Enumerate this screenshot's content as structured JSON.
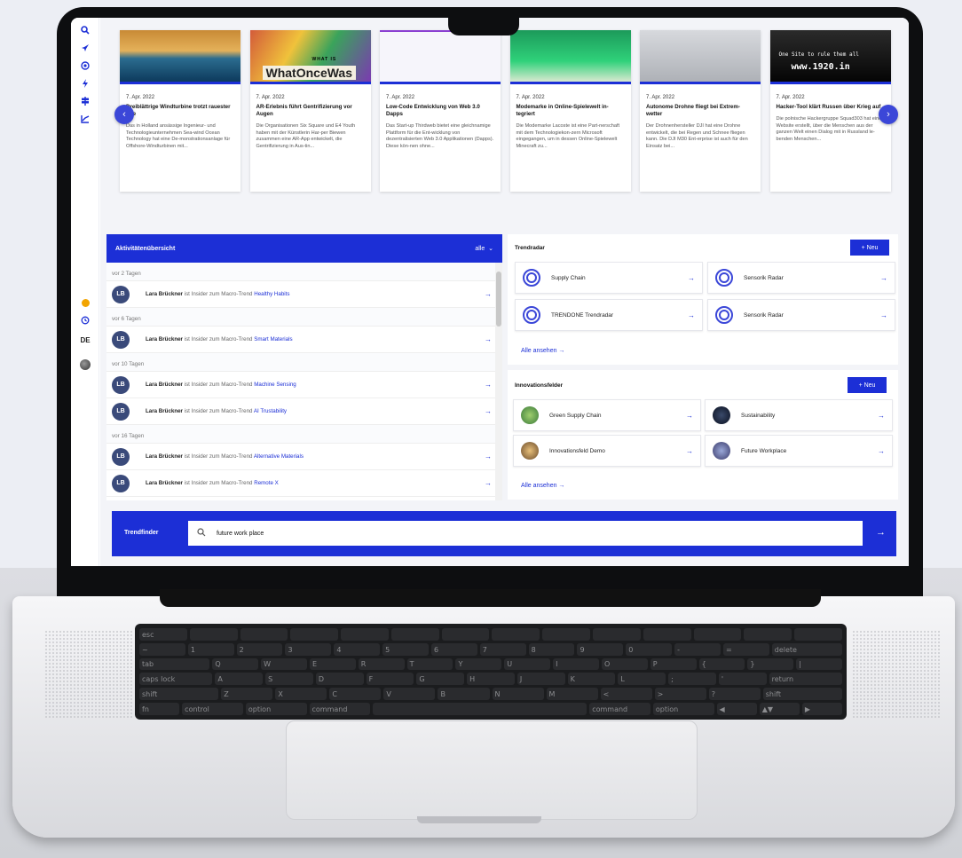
{
  "sidebar": {
    "icons": [
      "search-icon",
      "rocket-icon",
      "radar-icon",
      "bolt-icon",
      "signpost-icon",
      "chart-icon"
    ],
    "language": "DE"
  },
  "news": [
    {
      "date": "7. Apr. 2022",
      "title": "Dreiblättrige Windturbine trotzt rauester See",
      "text": "Das in Holland ansässige Ingenieur- und Technologieunternehmen Sea-wind Ocean Technology hat eine De-monstrationsanlage für Offshore-Windturbinen mit...",
      "img_caption": ""
    },
    {
      "date": "7. Apr. 2022",
      "title": "AR-Erlebnis führt Gentrifizierung vor Augen",
      "text": "Die Organisationen Six Square und E4 Youth haben mit der Künstlerin Har-per Biewen zusammen eine AR-App entwickelt, die Gentrifizierung in Aus-tin...",
      "img_caption": "WhatOnceWas",
      "img_caption_small": "WHAT IS"
    },
    {
      "date": "7. Apr. 2022",
      "title": "Low-Code Entwicklung von Web 3.0 Dapps",
      "text": "Das Start-up Thirdweb bietet eine gleichnamige Plattform für die Ent-wicklung von dezentralisierten Web 3.0 Applikationen (Dapps). Diese kön-nen ohne...",
      "img_caption": ""
    },
    {
      "date": "7. Apr. 2022",
      "title": "Modemarke in Online-Spielewelt in-tegriert",
      "text": "Die Modemarke Lacoste ist eine Part-nerschaft mit dem Technologiekon-zern Microsoft eingegangen, um in dessen Online-Spielewelt Minecraft zu...",
      "img_caption": ""
    },
    {
      "date": "7. Apr. 2022",
      "title": "Autonome Drohne fliegt bei Extrem-wetter",
      "text": "Der Drohnenhersteller DJI hat eine Drohne entwickelt, die bei Regen und Schnee fliegen kann. Die DJI M30 Ent-erprise ist auch für den Einsatz bei...",
      "img_caption": ""
    },
    {
      "date": "7. Apr. 2022",
      "title": "Hacker-Tool klärt Russen über Krieg auf",
      "text": "Die polnische Hackergruppe Squad303 hat eine Website erstellt, über die Menschen aus der ganzen Welt einen Dialog mit in Russland le-benden Menschen...",
      "img_caption": "www.1920.in",
      "img_caption_small": "One Site to rule them all"
    }
  ],
  "activity": {
    "title": "Aktivitätenübersicht",
    "filter": "alle",
    "groups": [
      {
        "label": "vor 2 Tagen",
        "items": [
          {
            "initials": "LB",
            "who": "Lara Brückner",
            "verb": "ist Insider zum Macro-Trend",
            "trend": "Healthy Habits"
          }
        ]
      },
      {
        "label": "vor 6 Tagen",
        "items": [
          {
            "initials": "LB",
            "who": "Lara Brückner",
            "verb": "ist Insider zum Macro-Trend",
            "trend": "Smart Materials"
          }
        ]
      },
      {
        "label": "vor 10 Tagen",
        "items": [
          {
            "initials": "LB",
            "who": "Lara Brückner",
            "verb": "ist Insider zum Macro-Trend",
            "trend": "Machine Sensing"
          },
          {
            "initials": "LB",
            "who": "Lara Brückner",
            "verb": "ist Insider zum Macro-Trend",
            "trend": "AI Trustability"
          }
        ]
      },
      {
        "label": "vor 16 Tagen",
        "items": [
          {
            "initials": "LB",
            "who": "Lara Brückner",
            "verb": "ist Insider zum Macro-Trend",
            "trend": "Alternative Materials"
          },
          {
            "initials": "LB",
            "who": "Lara Brückner",
            "verb": "ist Insider zum Macro-Trend",
            "trend": "Remote X"
          }
        ]
      }
    ]
  },
  "trendradar": {
    "title": "Trendradar",
    "new_label": "+ Neu",
    "items": [
      "Supply Chain",
      "Sensorik Radar",
      "TRENDONE Trendradar",
      "Sensorik Radar"
    ],
    "see_all": "Alle ansehen →"
  },
  "innovation": {
    "title": "Innovationsfelder",
    "new_label": "+ Neu",
    "items": [
      "Green Supply Chain",
      "Sustainability",
      "Innovationsfeld Demo",
      "Future Workplace"
    ],
    "see_all": "Alle ansehen →"
  },
  "trendfinder": {
    "label": "Trendfinder",
    "query": "future work place"
  },
  "keyboard": {
    "rows": [
      [
        "esc",
        "",
        "",
        "",
        "",
        "",
        "",
        "",
        "",
        "",
        "",
        "",
        "",
        ""
      ],
      [
        "~",
        "1",
        "2",
        "3",
        "4",
        "5",
        "6",
        "7",
        "8",
        "9",
        "0",
        "-",
        "=",
        "delete"
      ],
      [
        "tab",
        "Q",
        "W",
        "E",
        "R",
        "T",
        "Y",
        "U",
        "I",
        "O",
        "P",
        "{",
        "}",
        "|"
      ],
      [
        "caps lock",
        "A",
        "S",
        "D",
        "F",
        "G",
        "H",
        "J",
        "K",
        "L",
        ";",
        "'",
        "return"
      ],
      [
        "shift",
        "Z",
        "X",
        "C",
        "V",
        "B",
        "N",
        "M",
        "<",
        ">",
        "?",
        "shift"
      ],
      [
        "fn",
        "control",
        "option",
        "command",
        "",
        "command",
        "option",
        "◀",
        "▲▼",
        "▶"
      ]
    ]
  },
  "colors": {
    "accent": "#1c2fd6"
  }
}
